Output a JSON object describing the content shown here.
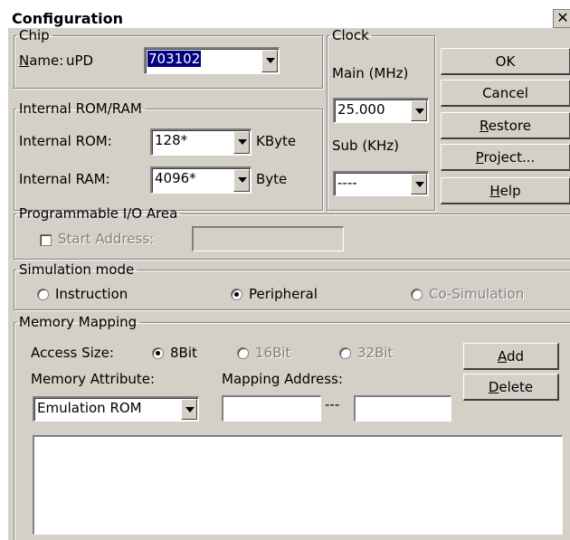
{
  "window": {
    "title": "Configuration",
    "close_glyph": "✕"
  },
  "chip": {
    "legend": "Chip",
    "name_label": "Name:",
    "prefix": "uPD",
    "value": "703102"
  },
  "rom_ram": {
    "legend": "Internal ROM/RAM",
    "rom_label": "Internal ROM:",
    "rom_value": "128*",
    "rom_unit": "KByte",
    "ram_label": "Internal RAM:",
    "ram_value": "4096*",
    "ram_unit": "Byte"
  },
  "clock": {
    "legend": "Clock",
    "main_label": "Main (MHz)",
    "main_value": "25.000",
    "sub_label": "Sub (KHz)",
    "sub_value": "----"
  },
  "buttons": {
    "ok": "OK",
    "cancel": "Cancel",
    "restore": "Restore",
    "project": "Project...",
    "help": "Help"
  },
  "pio": {
    "legend": "Programmable I/O Area",
    "start_label": "Start Address:",
    "start_value": "",
    "checked": false
  },
  "sim": {
    "legend": "Simulation mode",
    "options": [
      "Instruction",
      "Peripheral",
      "Co-Simulation"
    ],
    "selected": "Peripheral"
  },
  "mapping": {
    "legend": "Memory Mapping",
    "access_label": "Access Size:",
    "sizes": [
      "8Bit",
      "16Bit",
      "32Bit"
    ],
    "selected_size": "8Bit",
    "attr_label": "Memory Attribute:",
    "attr_value": "Emulation ROM",
    "addr_label": "Mapping Address:",
    "addr_sep": "---",
    "addr_from": "",
    "addr_to": "",
    "add": "Add",
    "delete": "Delete",
    "list_items": []
  }
}
